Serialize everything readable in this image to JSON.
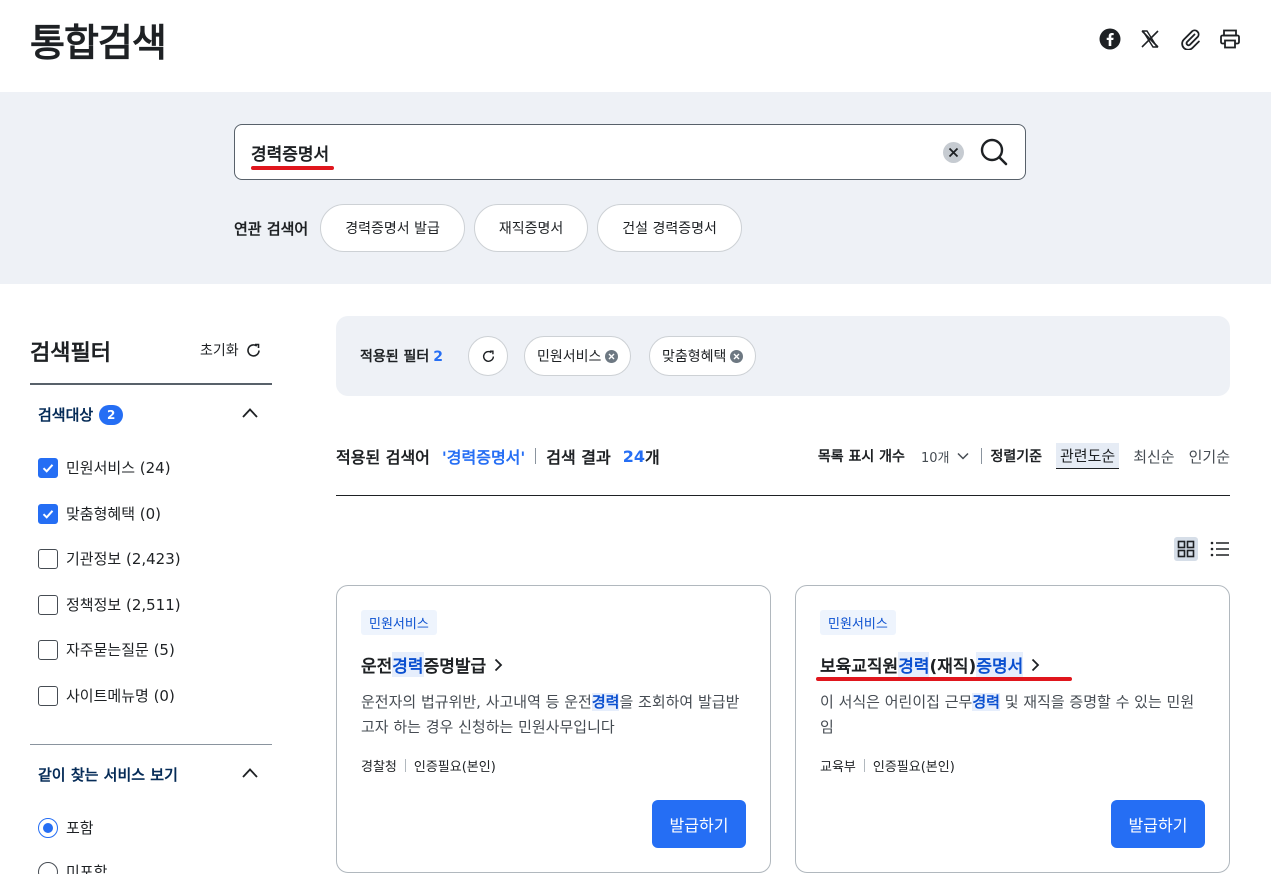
{
  "page": {
    "title": "통합검색"
  },
  "share": [
    "facebook-icon",
    "x-icon",
    "attachment-icon",
    "print-icon"
  ],
  "search": {
    "value": "경력증명서",
    "clear_icon": "close-icon",
    "search_icon": "search-icon"
  },
  "related": {
    "label": "연관 검색어",
    "items": [
      "경력증명서 발급",
      "재직증명서",
      "건설 경력증명서"
    ]
  },
  "sidebar": {
    "title": "검색필터",
    "reset_label": "초기화",
    "target": {
      "label": "검색대상",
      "badge": "2",
      "items": [
        {
          "label": "민원서비스 (24)",
          "checked": true
        },
        {
          "label": "맞춤형혜택 (0)",
          "checked": true
        },
        {
          "label": "기관정보 (2,423)",
          "checked": false
        },
        {
          "label": "정책정보 (2,511)",
          "checked": false
        },
        {
          "label": "자주묻는질문 (5)",
          "checked": false
        },
        {
          "label": "사이트메뉴명 (0)",
          "checked": false
        }
      ]
    },
    "together": {
      "label": "같이 찾는 서비스 보기",
      "options": [
        {
          "label": "포함",
          "selected": true
        },
        {
          "label": "미포함",
          "selected": false
        }
      ]
    }
  },
  "applied": {
    "label": "적용된 필터",
    "count": "2",
    "chips": [
      "민원서비스",
      "맞춤형혜택"
    ]
  },
  "result": {
    "keyword_label": "적용된 검색어",
    "keyword": "'경력증명서'",
    "count_label": "검색 결과",
    "count": "24",
    "count_unit": "개",
    "list_count_label": "목록 표시 개수",
    "list_count_value": "10개",
    "sort_label": "정렬기준",
    "sorts": [
      "관련도순",
      "최신순",
      "인기순"
    ],
    "active_sort": "관련도순"
  },
  "cards": [
    {
      "tag": "민원서비스",
      "title_parts": [
        "운전",
        "경력",
        "증명발급"
      ],
      "desc_parts": [
        "운전자의 법규위반, 사고내역 등 운전",
        "경력",
        "을 조회하여 발급받고자 하는 경우 신청하는 민원사무입니다"
      ],
      "org": "경찰청",
      "auth": "인증필요(본인)",
      "button": "발급하기"
    },
    {
      "tag": "민원서비스",
      "title_parts": [
        "보육교직원 ",
        "경력",
        "(재직) ",
        "증명서"
      ],
      "desc_parts": [
        "이 서식은 어린이집 근무",
        "경력",
        " 및 재직을 증명할 수 있는 민원임"
      ],
      "org": "교육부",
      "auth": "인증필요(본인)",
      "button": "발급하기"
    }
  ],
  "colors": {
    "accent": "#256ef4",
    "highlight_text": "#0b50d0",
    "underline": "#e0161d",
    "band": "#eef1f6"
  }
}
